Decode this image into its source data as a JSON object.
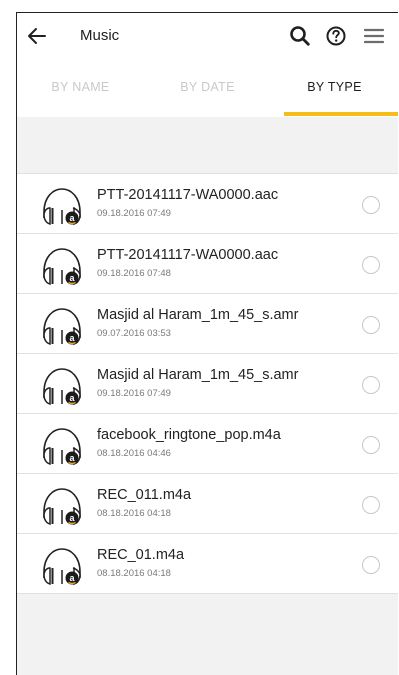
{
  "header": {
    "title": "Music"
  },
  "tabs": [
    {
      "label": "BY NAME"
    },
    {
      "label": "BY DATE"
    },
    {
      "label": "BY TYPE"
    }
  ],
  "files": [
    {
      "name": "PTT-20141117-WA0000.aac",
      "date": "09.18.2016 07:49"
    },
    {
      "name": "PTT-20141117-WA0000.aac",
      "date": "09.18.2016 07:48"
    },
    {
      "name": "Masjid al Haram_1m_45_s.amr",
      "date": "09.07.2016 03:53"
    },
    {
      "name": "Masjid al Haram_1m_45_s.amr",
      "date": "09.18.2016 07:49"
    },
    {
      "name": "facebook_ringtone_pop.m4a",
      "date": "08.18.2016 04:46"
    },
    {
      "name": "REC_011.m4a",
      "date": "08.18.2016 04:18"
    },
    {
      "name": "REC_01.m4a",
      "date": "08.18.2016 04:18"
    }
  ],
  "colors": {
    "accent": "#f4bd1a",
    "brand_badge": "#f5a623"
  },
  "icons": {
    "back": "arrow-left-icon",
    "search": "search-icon",
    "help": "help-circle-icon",
    "menu": "hamburger-menu-icon",
    "file": "amazon-music-file-icon"
  }
}
